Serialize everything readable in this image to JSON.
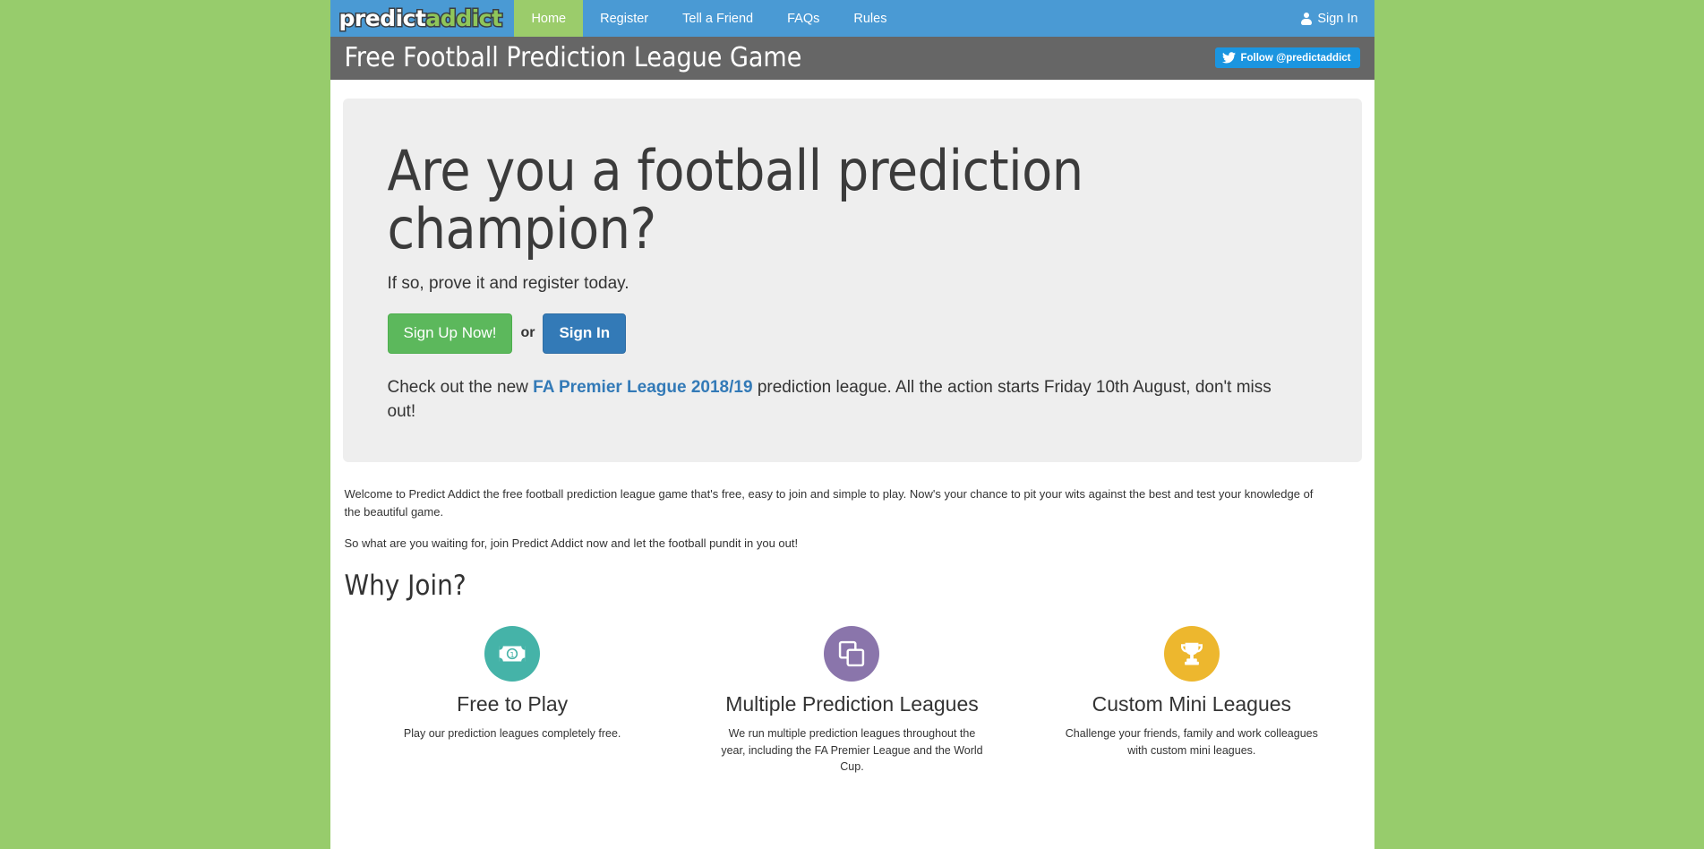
{
  "colors": {
    "page_background": "#97cc6c",
    "navbar": "#4a9ad4",
    "nav_active": "#9bcc6b",
    "header_bar": "#666666",
    "hero_background": "#eeeeee",
    "link": "#337ab7",
    "btn_success": "#5cb85c",
    "btn_primary": "#337ab7",
    "twitter": "#1b95e0",
    "feature_teal": "#45b3a8",
    "feature_purple": "#8a75ab",
    "feature_gold": "#edb72e"
  },
  "navbar": {
    "brand": {
      "part1": "predict",
      "part2": "addict",
      "icon": "brand-logo"
    },
    "links": [
      {
        "label": "Home",
        "active": true
      },
      {
        "label": "Register",
        "active": false
      },
      {
        "label": "Tell a Friend",
        "active": false
      },
      {
        "label": "FAQs",
        "active": false
      },
      {
        "label": "Rules",
        "active": false
      }
    ],
    "sign_in": {
      "label": "Sign In",
      "icon": "user-icon"
    }
  },
  "header": {
    "title": "Free Football Prediction League Game",
    "twitter_button": {
      "label": "Follow @predictaddict",
      "icon": "twitter-bird-icon"
    }
  },
  "hero": {
    "heading": "Are you a football prediction champion?",
    "lead": "If so, prove it and register today.",
    "sign_up_label": "Sign Up Now!",
    "or_label": "or",
    "sign_in_label": "Sign In",
    "promo_prefix": "Check out the new ",
    "promo_link": "FA Premier League 2018/19",
    "promo_suffix": " prediction league. All the action starts Friday 10th August, don't miss out!"
  },
  "body": {
    "paragraph1": "Welcome to Predict Addict the free football prediction league game that's free, easy to join and simple to play. Now's your chance to pit your wits against the best and test your knowledge of the beautiful game.",
    "paragraph2": "So what are you waiting for, join Predict Addict now and let the football pundit in you out!",
    "why_join_heading": "Why Join?"
  },
  "features": [
    {
      "icon": "money-note-icon",
      "title": "Free to Play",
      "description": "Play our prediction leagues completely free."
    },
    {
      "icon": "clone-squares-icon",
      "title": "Multiple Prediction Leagues",
      "description": "We run multiple prediction leagues throughout the year, including the FA Premier League and the World Cup."
    },
    {
      "icon": "trophy-icon",
      "title": "Custom Mini Leagues",
      "description": "Challenge your friends, family and work colleagues with custom mini leagues."
    }
  ]
}
